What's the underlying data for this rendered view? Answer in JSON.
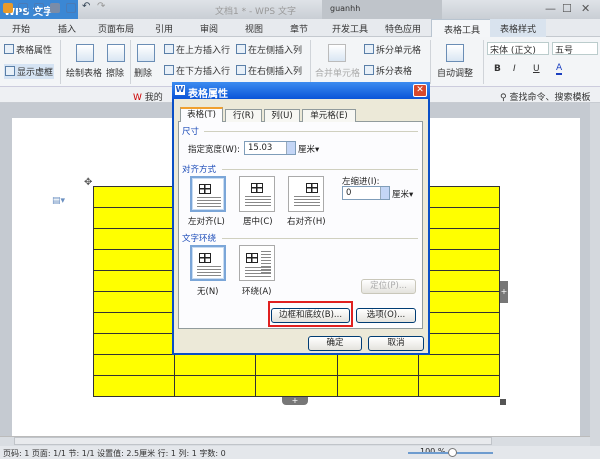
{
  "app": {
    "name": "WPS 文字",
    "doc_title": "文档1 * - WPS 文字",
    "user": "guanhh"
  },
  "tabs": [
    "开始",
    "插入",
    "页面布局",
    "引用",
    "审阅",
    "视图",
    "章节",
    "开发工具",
    "特色应用",
    "表格工具",
    "表格样式"
  ],
  "ribbon": {
    "table_props": "表格属性",
    "show_gridlines": "显示虚框",
    "draw_table": "绘制表格",
    "eraser": "擦除",
    "delete": "删除",
    "insert_above": "在上方插入行",
    "insert_below": "在下方插入行",
    "insert_left": "在左侧插入列",
    "insert_right": "在右侧插入列",
    "merge": "合并单元格",
    "split_cell": "拆分单元格",
    "split_table": "拆分表格",
    "autofit": "自动调整",
    "font": "宋体 (正文)",
    "size": "五号",
    "bold": "B",
    "italic": "I",
    "underline": "U",
    "fontcolor": "A"
  },
  "quick": {
    "mydoc": "我的",
    "search": "查找命令、搜索模板"
  },
  "dialog": {
    "title": "表格属性",
    "tabs": [
      "表格(T)",
      "行(R)",
      "列(U)",
      "单元格(E)"
    ],
    "size_section": "尺寸",
    "width_label": "指定宽度(W):",
    "width_value": "15.03",
    "width_unit": "厘米▾",
    "align_section": "对齐方式",
    "align_options": [
      "左对齐(L)",
      "居中(C)",
      "右对齐(H)"
    ],
    "indent_label": "左缩进(I):",
    "indent_value": "0",
    "indent_unit": "厘米▾",
    "wrap_section": "文字环绕",
    "wrap_options": [
      "无(N)",
      "环绕(A)"
    ],
    "position_btn": "定位(P)...",
    "borders_btn": "边框和底纹(B)...",
    "options_btn": "选项(O)...",
    "ok": "确定",
    "cancel": "取消"
  },
  "status": {
    "text": "页码: 1  页面: 1/1  节: 1/1  设置值: 2.5厘米  行: 1  列: 1  字数: 0",
    "zoom": "100 %"
  },
  "colors": {
    "table_fill": "#ffff00",
    "highlight": "#e02020",
    "accent": "#3b87d4"
  }
}
